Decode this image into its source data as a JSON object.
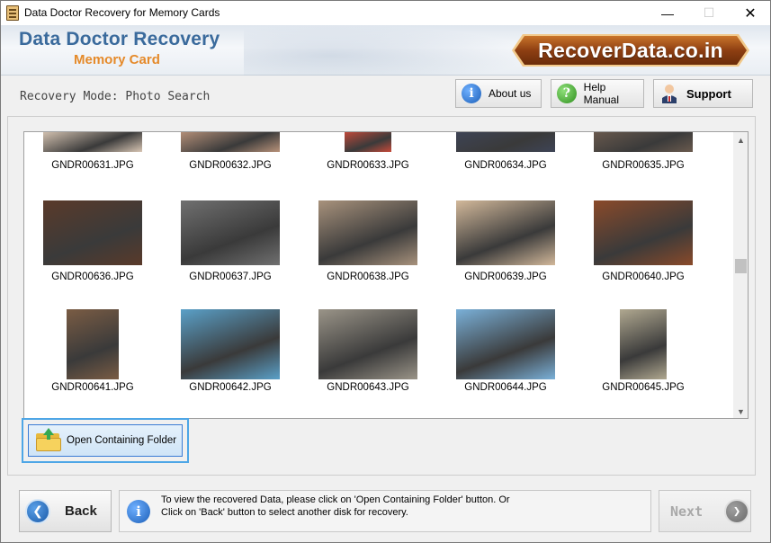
{
  "window": {
    "title": "Data Doctor Recovery for Memory Cards",
    "minimize": "—",
    "maximize": "☐",
    "close": "✕"
  },
  "header": {
    "brand_main": "Data Doctor Recovery",
    "brand_sub": "Memory Card",
    "logo_text": "RecoverData.co.in"
  },
  "modebar": {
    "mode_label": "Recovery Mode: Photo Search",
    "about_label": "About us",
    "help_label": "Help Manual",
    "support_label": "Support"
  },
  "gallery": {
    "items": [
      {
        "name": "GNDR00631.JPG",
        "color": "#d8c6b4"
      },
      {
        "name": "GNDR00632.JPG",
        "color": "#b8927a"
      },
      {
        "name": "GNDR00633.JPG",
        "color": "#c84a3a"
      },
      {
        "name": "GNDR00634.JPG",
        "color": "#3e4456"
      },
      {
        "name": "GNDR00635.JPG",
        "color": "#6a5a4e"
      },
      {
        "name": "GNDR00636.JPG",
        "color": "#5a3a2a"
      },
      {
        "name": "GNDR00637.JPG",
        "color": "#707070"
      },
      {
        "name": "GNDR00638.JPG",
        "color": "#a8927c"
      },
      {
        "name": "GNDR00639.JPG",
        "color": "#d2b89a"
      },
      {
        "name": "GNDR00640.JPG",
        "color": "#8a4a2a"
      },
      {
        "name": "GNDR00641.JPG",
        "color": "#7a5c44"
      },
      {
        "name": "GNDR00642.JPG",
        "color": "#5aa0c8"
      },
      {
        "name": "GNDR00643.JPG",
        "color": "#9a9488"
      },
      {
        "name": "GNDR00644.JPG",
        "color": "#7ab0d8"
      },
      {
        "name": "GNDR00645.JPG",
        "color": "#b0a890"
      }
    ]
  },
  "actions": {
    "open_folder_label": "Open Containing Folder"
  },
  "footer": {
    "back_label": "Back",
    "info_line1": "To view the recovered Data, please click on 'Open Containing Folder' button. Or",
    "info_line2": "Click on 'Back' button to select another disk for recovery.",
    "next_label": "Next"
  }
}
